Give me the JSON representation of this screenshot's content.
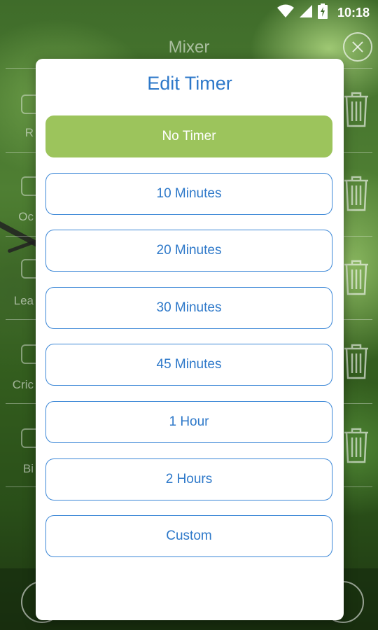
{
  "status_bar": {
    "time": "10:18",
    "icons": [
      "wifi-icon",
      "cell-signal-icon",
      "battery-icon"
    ]
  },
  "mixer": {
    "title": "Mixer",
    "rows": [
      {
        "label_fragment": "R"
      },
      {
        "label_fragment": "Oc"
      },
      {
        "label_fragment": "Lea"
      },
      {
        "label_fragment": "Cric"
      },
      {
        "label_fragment": "Bi"
      }
    ]
  },
  "dialog": {
    "title": "Edit Timer",
    "selected_index": 0,
    "options": [
      {
        "label": "No Timer"
      },
      {
        "label": "10 Minutes"
      },
      {
        "label": "20 Minutes"
      },
      {
        "label": "30 Minutes"
      },
      {
        "label": "45 Minutes"
      },
      {
        "label": "1 Hour"
      },
      {
        "label": "2 Hours"
      },
      {
        "label": "Custom"
      }
    ]
  },
  "colors": {
    "accent_blue": "#2d78c9",
    "selected_green": "#9cc45c",
    "dialog_bg": "#ffffff"
  }
}
